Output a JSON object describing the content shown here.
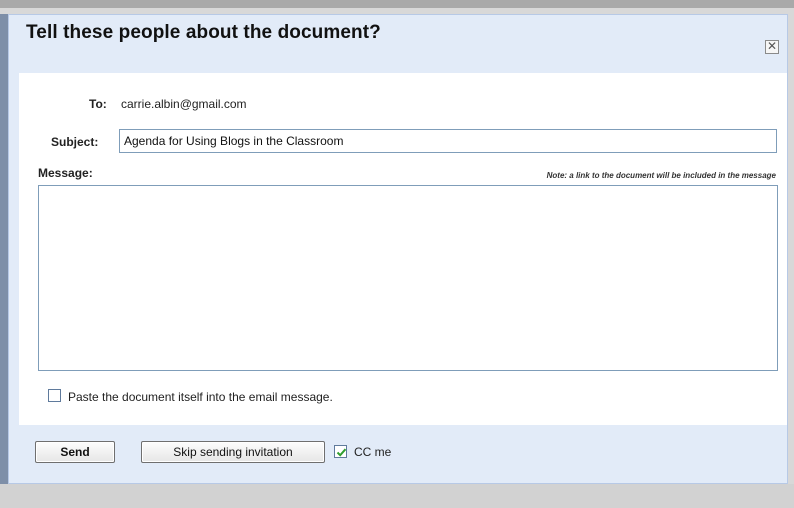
{
  "dialog": {
    "title": "Tell these people about the document?",
    "close_icon": "close-icon"
  },
  "to": {
    "label": "To:",
    "value": "carrie.albin@gmail.com"
  },
  "subject": {
    "label": "Subject:",
    "value": "Agenda for Using Blogs in the Classroom"
  },
  "message": {
    "label": "Message:",
    "note": "Note: a link to the document will be included in the message",
    "value": ""
  },
  "paste_option": {
    "label": "Paste the document itself into the email message.",
    "checked": false
  },
  "actions": {
    "send_label": "Send",
    "skip_label": "Skip sending invitation",
    "cc_label": "CC me",
    "cc_checked": true
  },
  "colors": {
    "dialog_background": "#e2ebf8",
    "checkmark": "#2f9e2f"
  }
}
